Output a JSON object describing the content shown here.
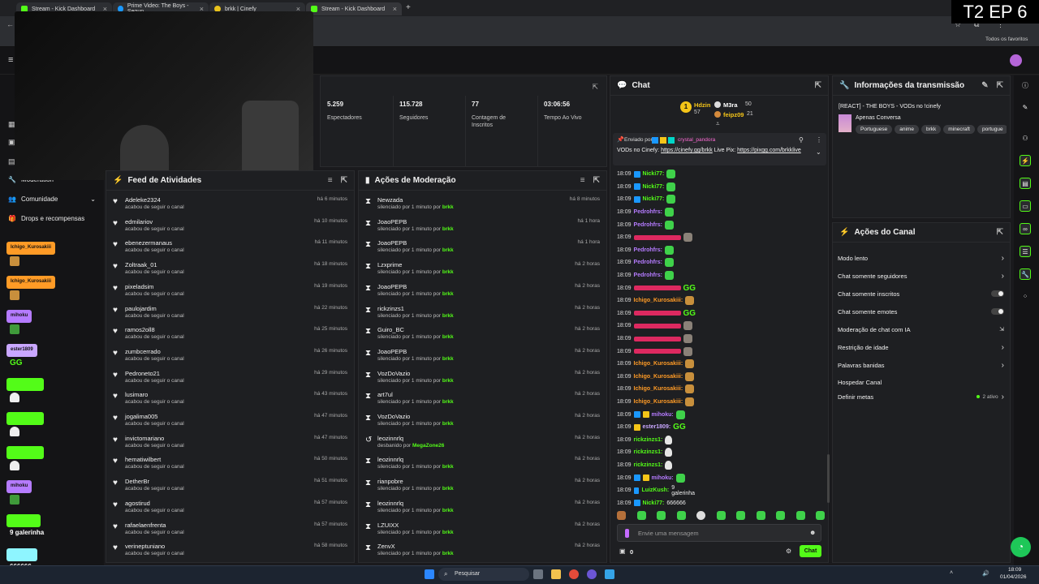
{
  "browser": {
    "tabs": [
      {
        "label": "Stream - Kick Dashboard",
        "color": "#53fc18"
      },
      {
        "label": "Prime Video: The Boys - Segun",
        "color": "#1a98ff"
      },
      {
        "label": "brkk | Cinefy",
        "color": "#e8c21c"
      },
      {
        "label": "Stream - Kick Dashboard",
        "color": "#53fc18"
      }
    ],
    "bookmarks_label": "Todos os favoritos"
  },
  "overlay": {
    "episode": "T2 EP 6"
  },
  "stats": [
    {
      "value": "5.259",
      "label": "Espectadores"
    },
    {
      "value": "115.728",
      "label": "Seguidores"
    },
    {
      "value": "77",
      "label": "Contagem de Inscritos"
    },
    {
      "value": "03:06:56",
      "label": "Tempo Ao Vivo"
    }
  ],
  "left_nav": {
    "moderation": "Moderation",
    "community": "Comunidade",
    "drops": "Drops e recompensas",
    "tags": [
      {
        "label": "Ichigo_Kurosakiii",
        "color": "#ff9b26"
      },
      {
        "label": "Ichigo_Kurosakiii",
        "color": "#ff9b26"
      },
      {
        "label": "mihoku",
        "color": "#b57bff"
      },
      {
        "label": "ester1809",
        "color": "#c9a7ff"
      },
      {
        "label": "",
        "color": "#53fc18"
      },
      {
        "label": "",
        "color": "#53fc18"
      },
      {
        "label": "",
        "color": "#53fc18"
      },
      {
        "label": "mihoku",
        "color": "#b57bff"
      },
      {
        "label": "",
        "color": "#53fc18"
      },
      {
        "label": "",
        "color": "#8ef5ff"
      }
    ],
    "bottom_messages": [
      "9 galerinha",
      "666666"
    ]
  },
  "activity": {
    "title": "Feed de Atividades",
    "items": [
      {
        "name": "Adeleke2324",
        "sub": "acabou de seguir o canal",
        "time": "há 6 minutos"
      },
      {
        "name": "edmilariov",
        "sub": "acabou de seguir o canal",
        "time": "há 10 minutos"
      },
      {
        "name": "ebenezermanaus",
        "sub": "acabou de seguir o canal",
        "time": "há 11 minutos"
      },
      {
        "name": "Zoltraak_01",
        "sub": "acabou de seguir o canal",
        "time": "há 18 minutos"
      },
      {
        "name": "pixeladsim",
        "sub": "acabou de seguir o canal",
        "time": "há 19 minutos"
      },
      {
        "name": "paulojardim",
        "sub": "acabou de seguir o canal",
        "time": "há 22 minutos"
      },
      {
        "name": "ramos2oll8",
        "sub": "acabou de seguir o canal",
        "time": "há 25 minutos"
      },
      {
        "name": "zumbcerrado",
        "sub": "acabou de seguir o canal",
        "time": "há 26 minutos"
      },
      {
        "name": "Pedroneto21",
        "sub": "acabou de seguir o canal",
        "time": "há 29 minutos"
      },
      {
        "name": "lusimaro",
        "sub": "acabou de seguir o canal",
        "time": "há 43 minutos"
      },
      {
        "name": "jogalima005",
        "sub": "acabou de seguir o canal",
        "time": "há 47 minutos"
      },
      {
        "name": "invictomariano",
        "sub": "acabou de seguir o canal",
        "time": "há 47 minutos"
      },
      {
        "name": "hematiwilbert",
        "sub": "acabou de seguir o canal",
        "time": "há 50 minutos"
      },
      {
        "name": "DetherBr",
        "sub": "acabou de seguir o canal",
        "time": "há 51 minutos"
      },
      {
        "name": "agostirud",
        "sub": "acabou de seguir o canal",
        "time": "há 57 minutos"
      },
      {
        "name": "rafaelaenfrenta",
        "sub": "acabou de seguir o canal",
        "time": "há 57 minutos"
      },
      {
        "name": "verineptuniano",
        "sub": "acabou de seguir o canal",
        "time": "há 58 minutos"
      }
    ]
  },
  "moderation": {
    "title": "Ações de Moderação",
    "items": [
      {
        "name": "Newzada",
        "sub": "silenciado por 1 minuto por",
        "by": "brkk",
        "time": "há 8 minutos",
        "icon": "hourglass"
      },
      {
        "name": "JoaoPEPB",
        "sub": "silenciado por 1 minuto por",
        "by": "brkk",
        "time": "há 1 hora",
        "icon": "hourglass"
      },
      {
        "name": "JoaoPEPB",
        "sub": "silenciado por 1 minuto por",
        "by": "brkk",
        "time": "há 1 hora",
        "icon": "hourglass"
      },
      {
        "name": "Lzxprime",
        "sub": "silenciado por 1 minuto por",
        "by": "brkk",
        "time": "há 2 horas",
        "icon": "hourglass"
      },
      {
        "name": "JoaoPEPB",
        "sub": "silenciado por 1 minuto por",
        "by": "brkk",
        "time": "há 2 horas",
        "icon": "hourglass"
      },
      {
        "name": "rickzinzs1",
        "sub": "silenciado por 1 minuto por",
        "by": "brkk",
        "time": "há 2 horas",
        "icon": "hourglass"
      },
      {
        "name": "Guiro_BC",
        "sub": "silenciado por 1 minuto por",
        "by": "brkk",
        "time": "há 2 horas",
        "icon": "hourglass"
      },
      {
        "name": "JoaoPEPB",
        "sub": "silenciado por 1 minuto por",
        "by": "brkk",
        "time": "há 2 horas",
        "icon": "hourglass"
      },
      {
        "name": "VozDoVazio",
        "sub": "silenciado por 1 minuto por",
        "by": "brkk",
        "time": "há 2 horas",
        "icon": "hourglass"
      },
      {
        "name": "art7ul",
        "sub": "silenciado por 1 minuto por",
        "by": "brkk",
        "time": "há 2 horas",
        "icon": "hourglass"
      },
      {
        "name": "VozDoVazio",
        "sub": "silenciado por 1 minuto por",
        "by": "brkk",
        "time": "há 2 horas",
        "icon": "hourglass"
      },
      {
        "name": "leozinnrlq",
        "sub": "desbanido por",
        "by": "MegaZone26",
        "time": "há 2 horas",
        "icon": "undo"
      },
      {
        "name": "leozinnrlq",
        "sub": "silenciado por 1 minuto por",
        "by": "brkk",
        "time": "há 2 horas",
        "icon": "hourglass"
      },
      {
        "name": "rianpobre",
        "sub": "silenciado por 1 minuto por",
        "by": "brkk",
        "time": "há 2 horas",
        "icon": "hourglass"
      },
      {
        "name": "leozinnrlq",
        "sub": "silenciado por 1 minuto por",
        "by": "brkk",
        "time": "há 2 horas",
        "icon": "hourglass"
      },
      {
        "name": "LZUIXX",
        "sub": "silenciado por 1 minuto por",
        "by": "brkk",
        "time": "há 2 horas",
        "icon": "hourglass"
      },
      {
        "name": "ZenvX",
        "sub": "silenciado por 1 minuto por",
        "by": "brkk",
        "time": "há 2 horas",
        "icon": "hourglass"
      }
    ]
  },
  "chat": {
    "title": "Chat",
    "leaderboard": {
      "first": {
        "rank": "1",
        "name": "Hdzin",
        "count": "57"
      },
      "second": {
        "name": "M3ra",
        "count": "50"
      },
      "third": {
        "name": "feipz09",
        "count": "21"
      }
    },
    "pinned": {
      "sent_by_label": "Enviado por",
      "author": "crystal_pandora",
      "text_pre": "VODs no Cinefy:",
      "link1": "https://cinefy.gg/brkk",
      "text_mid": "Live Pix:",
      "link2": "https://pixgg.com/brkklive"
    },
    "messages": [
      {
        "time": "18:09",
        "user": "Nicki77:",
        "color": "#53fc18",
        "emote": "ghost-green",
        "text": ""
      },
      {
        "time": "18:09",
        "user": "Nicki77:",
        "color": "#53fc18",
        "emote": "ghost-green",
        "text": ""
      },
      {
        "time": "18:09",
        "user": "Nicki77:",
        "color": "#53fc18",
        "emote": "ghost-green",
        "text": ""
      },
      {
        "time": "18:09",
        "user": "Pedrohfrs:",
        "color": "#b57bff",
        "emote": "green",
        "text": ""
      },
      {
        "time": "18:09",
        "user": "Pedrohfrs:",
        "color": "#b57bff",
        "emote": "green",
        "text": ""
      },
      {
        "time": "18:09",
        "user": "",
        "color": "#ff2b6b",
        "emote": "pic",
        "text": ""
      },
      {
        "time": "18:09",
        "user": "Pedrohfrs:",
        "color": "#b57bff",
        "emote": "green",
        "text": ""
      },
      {
        "time": "18:09",
        "user": "Pedrohfrs:",
        "color": "#b57bff",
        "emote": "green",
        "text": ""
      },
      {
        "time": "18:09",
        "user": "Pedrohfrs:",
        "color": "#b57bff",
        "emote": "green",
        "text": ""
      },
      {
        "time": "18:09",
        "user": "",
        "color": "#ff2b6b",
        "emote": "gg",
        "text": ""
      },
      {
        "time": "18:09",
        "user": "Ichigo_Kurosakiii:",
        "color": "#ff9b26",
        "emote": "face",
        "text": ""
      },
      {
        "time": "18:09",
        "user": "",
        "color": "#ff2b6b",
        "emote": "gg",
        "text": ""
      },
      {
        "time": "18:09",
        "user": "",
        "color": "#ff2b6b",
        "emote": "pic",
        "text": ""
      },
      {
        "time": "18:09",
        "user": "",
        "color": "#ff2b6b",
        "emote": "pic",
        "text": ""
      },
      {
        "time": "18:09",
        "user": "",
        "color": "#ff2b6b",
        "emote": "pic",
        "text": ""
      },
      {
        "time": "18:09",
        "user": "Ichigo_Kurosakiii:",
        "color": "#ff9b26",
        "emote": "face",
        "text": ""
      },
      {
        "time": "18:09",
        "user": "Ichigo_Kurosakiii:",
        "color": "#ff9b26",
        "emote": "face",
        "text": ""
      },
      {
        "time": "18:09",
        "user": "Ichigo_Kurosakiii:",
        "color": "#ff9b26",
        "emote": "face",
        "text": ""
      },
      {
        "time": "18:09",
        "user": "Ichigo_Kurosakiii:",
        "color": "#ff9b26",
        "emote": "face",
        "text": ""
      },
      {
        "time": "18:09",
        "user": "mihoku:",
        "color": "#b57bff",
        "emote": "green",
        "text": ""
      },
      {
        "time": "18:09",
        "user": "ester1809:",
        "color": "#c9a7ff",
        "emote": "gg",
        "text": ""
      },
      {
        "time": "18:09",
        "user": "rickzinzs1:",
        "color": "#53fc18",
        "emote": "ghost",
        "text": ""
      },
      {
        "time": "18:09",
        "user": "rickzinzs1:",
        "color": "#53fc18",
        "emote": "ghost",
        "text": ""
      },
      {
        "time": "18:09",
        "user": "rickzinzs1:",
        "color": "#53fc18",
        "emote": "ghost",
        "text": ""
      },
      {
        "time": "18:09",
        "user": "mihoku:",
        "color": "#b57bff",
        "emote": "green",
        "text": ""
      },
      {
        "time": "18:09",
        "user": "LuizKush:",
        "color": "#53fc18",
        "emote": "",
        "text": "9 galerinha"
      },
      {
        "time": "18:09",
        "user": "Nicki77:",
        "color": "#53fc18",
        "emote": "",
        "text": "666666"
      }
    ],
    "input_placeholder": "Envie uma mensagem",
    "send_label": "Chat",
    "points": "0"
  },
  "stream_info": {
    "title": "Informações da transmissão",
    "stream_title": "[REACT] - THE BOYS - VODs no !cinefy",
    "category": "Apenas Conversa",
    "tags": [
      "Portuguese",
      "anime",
      "brkk",
      "minecraft",
      "portugue"
    ]
  },
  "channel_actions": {
    "title": "Ações do Canal",
    "items": [
      {
        "label": "Modo lento",
        "control": "chevron"
      },
      {
        "label": "Chat somente seguidores",
        "control": "chevron"
      },
      {
        "label": "Chat somente inscritos",
        "control": "toggle"
      },
      {
        "label": "Chat somente emotes",
        "control": "toggle"
      },
      {
        "label": "Moderação de chat com IA",
        "control": "external"
      },
      {
        "label": "Restrição de idade",
        "control": "chevron"
      },
      {
        "label": "Palavras banidas",
        "control": "chevron"
      },
      {
        "label": "Hospedar Canal",
        "control": "none"
      },
      {
        "label": "Definir metas",
        "control": "chevron",
        "status": "2 ativo"
      }
    ]
  },
  "taskbar": {
    "search": "Pesquisar",
    "time": "18:09",
    "date": "01/04/2026"
  }
}
